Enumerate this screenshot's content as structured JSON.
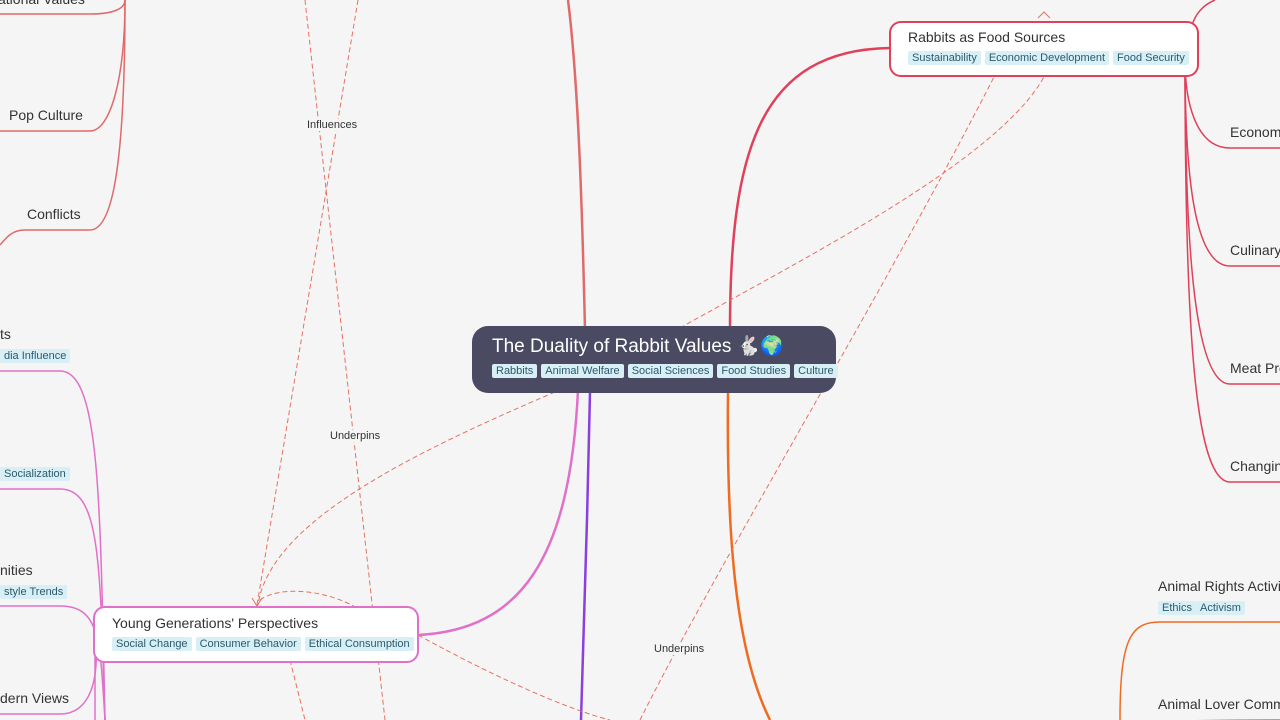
{
  "central": {
    "title": "The Duality of Rabbit Values",
    "emoji": "🐇🌍",
    "tags": [
      "Rabbits",
      "Animal Welfare",
      "Social Sciences",
      "Food Studies",
      "Culture"
    ]
  },
  "nodes": {
    "food_sources": {
      "title": "Rabbits as Food Sources",
      "tags": [
        "Sustainability",
        "Economic Development",
        "Food Security"
      ]
    },
    "young_generations": {
      "title": "Young Generations' Perspectives",
      "tags": [
        "Social Change",
        "Consumer Behavior",
        "Ethical Consumption"
      ]
    }
  },
  "left_labels": {
    "national_values": "ational Values",
    "pop_culture": "Pop Culture",
    "conflicts": "Conflicts",
    "ts": "ts",
    "media_influence_tag": "dia Influence",
    "socialization_tag": "Socialization",
    "nities": "nities",
    "lifestyle_tag": "style Trends",
    "modern_views": "dern Views"
  },
  "right_labels": {
    "economic": "Econom",
    "culinary": "Culinary",
    "meat_pro": "Meat Pro",
    "changing": "Changin",
    "animal_rights": "Animal Rights Activis",
    "animal_rights_tags": [
      "Ethics",
      "Activism"
    ],
    "animal_lover": "Animal Lover Comm"
  },
  "relations": {
    "influences": "Influences",
    "underpins_left": "Underpins",
    "underpins_bottom": "Underpins"
  },
  "colors": {
    "central_bg": "#4a4a63",
    "food_branch": "#e0405a",
    "young_branch": "#e070c8",
    "purple_branch": "#8a3fe0",
    "orange_branch": "#f06a20",
    "left_branch_top": "#e06a6a",
    "relation_dashed": "#e87060",
    "tag_bg": "#d8eff5"
  }
}
